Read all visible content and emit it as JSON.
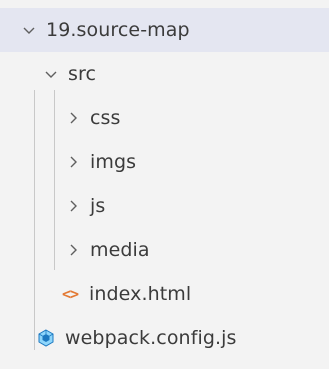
{
  "explorer": {
    "root_folder": {
      "label": "19.source-map",
      "expanded": true,
      "icon": "chevron-down-icon"
    },
    "src_folder": {
      "label": "src",
      "expanded": true,
      "icon": "chevron-down-icon"
    },
    "subfolders": [
      {
        "label": "css",
        "expanded": false,
        "icon": "chevron-right-icon"
      },
      {
        "label": "imgs",
        "expanded": false,
        "icon": "chevron-right-icon"
      },
      {
        "label": "js",
        "expanded": false,
        "icon": "chevron-right-icon"
      },
      {
        "label": "media",
        "expanded": false,
        "icon": "chevron-right-icon"
      }
    ],
    "html_file": {
      "label": "index.html",
      "icon": "html-file-icon",
      "icon_glyph": "<>",
      "icon_color": "#e37933"
    },
    "config_file": {
      "label": "webpack.config.js",
      "icon": "webpack-icon",
      "icon_color": "#4a90c8"
    },
    "colors": {
      "background": "#f3f3f3",
      "selected_row": "#e4e6f1",
      "text": "#3b3b3b",
      "chevron": "#5f5f5f",
      "guide_line": "#c8c8c8"
    }
  }
}
